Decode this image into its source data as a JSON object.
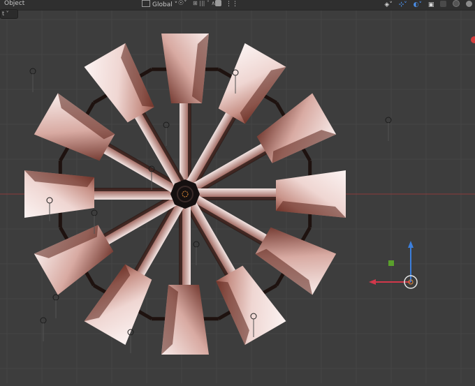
{
  "header": {
    "mode_label": "Object",
    "mode_dropdown_value": "",
    "transform_orientation": "Global",
    "snap_values": "|||",
    "right_icons": [
      "select-icon",
      "gizmo-icon",
      "overlay-icon",
      "xray-icon",
      "solid-shading-icon",
      "material-shading-icon",
      "rendered-shading-icon"
    ]
  },
  "viewport": {
    "background": "#3d3d3d",
    "grid_color": "#444444",
    "x_axis_color": "#8a3a3a",
    "blade_count": 12,
    "hub_color": "#1a1a1a",
    "blade_light": "#f4e8e6",
    "blade_dark": "#6b2a22",
    "spoke_color": "#2a1a16"
  },
  "gizmo": {
    "x_color": "#d2384b",
    "z_color": "#3c7fdc",
    "y_color": "#5aa02c"
  }
}
